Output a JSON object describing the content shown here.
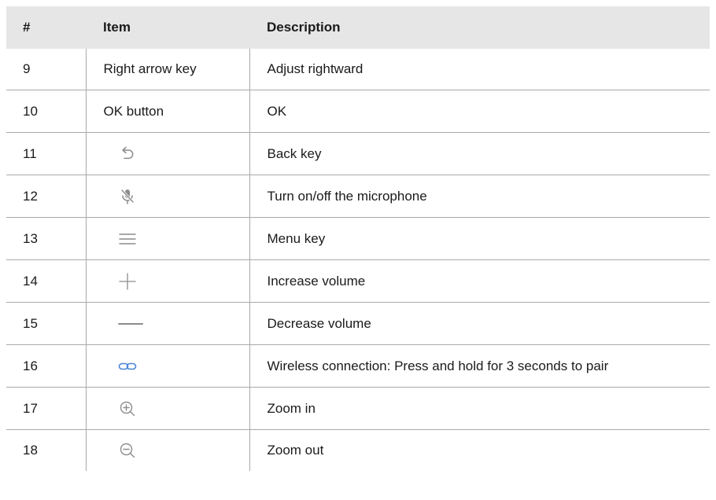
{
  "table": {
    "headers": {
      "num": "#",
      "item": "Item",
      "description": "Description"
    },
    "rows": [
      {
        "num": "9",
        "item": "Right arrow key",
        "description": "Adjust rightward"
      },
      {
        "num": "10",
        "item": "OK button",
        "description": "OK"
      },
      {
        "num": "11",
        "icon": "back-arrow-icon",
        "description": "Back key"
      },
      {
        "num": "12",
        "icon": "mic-mute-icon",
        "description": "Turn on/off the microphone"
      },
      {
        "num": "13",
        "icon": "menu-icon",
        "description": "Menu key"
      },
      {
        "num": "14",
        "icon": "plus-icon",
        "description": "Increase volume"
      },
      {
        "num": "15",
        "icon": "minus-icon",
        "description": "Decrease volume"
      },
      {
        "num": "16",
        "icon": "link-icon",
        "description": "Wireless connection: Press and hold for 3 seconds to pair"
      },
      {
        "num": "17",
        "icon": "zoom-in-icon",
        "description": "Zoom in"
      },
      {
        "num": "18",
        "icon": "zoom-out-icon",
        "description": "Zoom out"
      }
    ]
  },
  "colors": {
    "header_bg": "#e6e6e6",
    "icon_gray": "#8c8c8c",
    "link_blue": "#4a86d8",
    "border": "#a9a9a9"
  }
}
